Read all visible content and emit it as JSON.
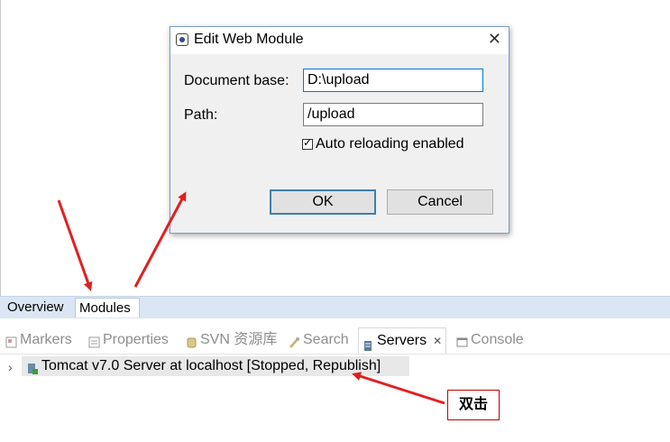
{
  "dialog": {
    "title": "Edit Web Module",
    "close_label": "✕",
    "document_base_label": "Document base:",
    "document_base_value": "D:\\upload",
    "path_label": "Path:",
    "path_value": "/upload",
    "auto_reload_label": "Auto reloading enabled",
    "auto_reload_checked": true,
    "ok_label": "OK",
    "cancel_label": "Cancel"
  },
  "page_tabs": [
    {
      "label": "Overview"
    },
    {
      "label": "Modules"
    }
  ],
  "views": [
    {
      "label": "Markers",
      "icon": "markers-icon"
    },
    {
      "label": "Properties",
      "icon": "properties-icon"
    },
    {
      "label": "SVN 资源库",
      "icon": "svn-icon"
    },
    {
      "label": "Search",
      "icon": "search-icon"
    },
    {
      "label": "Servers",
      "icon": "servers-icon",
      "active": true,
      "close": "✕"
    },
    {
      "label": "Console",
      "icon": "console-icon"
    }
  ],
  "server": {
    "expand": "›",
    "label": "Tomcat v7.0 Server at localhost  [Stopped, Republish]"
  },
  "callout": {
    "text": "双击"
  },
  "colors": {
    "arrow": "#e02020",
    "accent": "#0078d7",
    "tab_strip": "#dae6f3"
  }
}
